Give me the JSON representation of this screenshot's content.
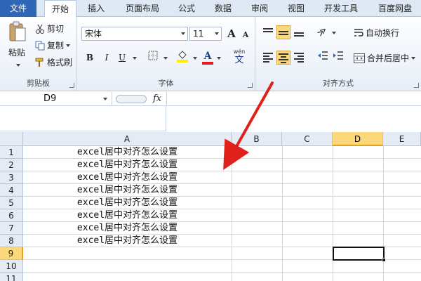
{
  "tabs": [
    "文件",
    "开始",
    "插入",
    "页面布局",
    "公式",
    "数据",
    "审阅",
    "视图",
    "开发工具",
    "百度网盘"
  ],
  "clipboard": {
    "paste": "粘贴",
    "cut": "剪切",
    "copy": "复制",
    "format_painter": "格式刷",
    "group_label": "剪贴板"
  },
  "font": {
    "name": "宋体",
    "size": "11",
    "group_label": "字体",
    "bold": "B",
    "italic": "I",
    "underline": "U",
    "wen": "wén",
    "wen_char": "文",
    "grow": "A",
    "shrink": "A",
    "color_letter": "A"
  },
  "alignment": {
    "wrap": "自动换行",
    "merge": "合并后居中",
    "group_label": "对齐方式",
    "orient": "≫"
  },
  "colors": {
    "accent": "#2f66b8",
    "selected_header": "#fbd87b",
    "arrow": "#e0201b"
  },
  "formula_bar": {
    "name_box": "D9",
    "fx": "fx",
    "formula": ""
  },
  "grid": {
    "columns": [
      "A",
      "B",
      "C",
      "D",
      "E"
    ],
    "selected_column": "D",
    "rows": [
      "1",
      "2",
      "3",
      "4",
      "5",
      "6",
      "7",
      "8",
      "9",
      "10",
      "11"
    ],
    "selected_row": "9",
    "cells_a": [
      "excel居中对齐怎么设置",
      "excel居中对齐怎么设置",
      "excel居中对齐怎么设置",
      "excel居中对齐怎么设置",
      "excel居中对齐怎么设置",
      "excel居中对齐怎么设置",
      "excel居中对齐怎么设置",
      "excel居中对齐怎么设置"
    ]
  }
}
